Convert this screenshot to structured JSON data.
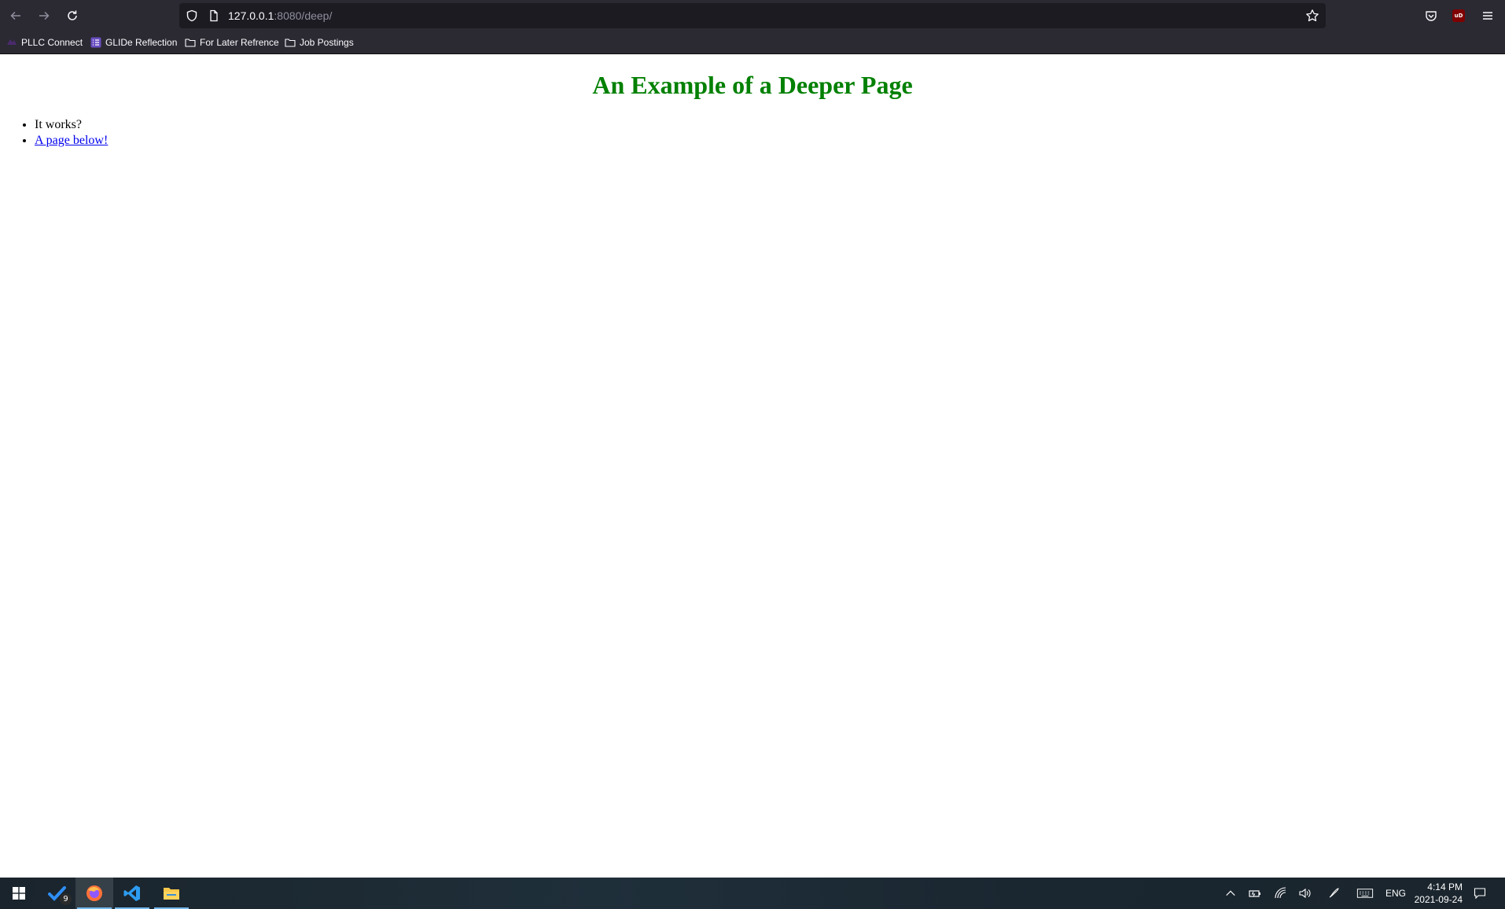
{
  "browser": {
    "url_host": "127.0.0.1",
    "url_path": ":8080/deep/",
    "bookmarks": [
      {
        "label": "PLLC Connect",
        "icon": "pllc-logo-icon"
      },
      {
        "label": "GLIDe Reflection",
        "icon": "list-icon"
      },
      {
        "label": "For Later Refrence",
        "icon": "folder-icon"
      },
      {
        "label": "Job Postings",
        "icon": "folder-icon"
      }
    ],
    "extension_badge": "uD"
  },
  "page": {
    "heading": "An Example of a Deeper Page",
    "heading_color": "#008000",
    "list_items": [
      {
        "text": "It works?",
        "is_link": false
      },
      {
        "text": "A page below!",
        "is_link": true
      }
    ]
  },
  "taskbar": {
    "apps": [
      "start-icon",
      "todo-icon",
      "firefox-icon",
      "vscode-icon",
      "file-explorer-icon"
    ],
    "todo_badge": "9",
    "language": "ENG",
    "time": "4:14 PM",
    "date": "2021-09-24"
  }
}
